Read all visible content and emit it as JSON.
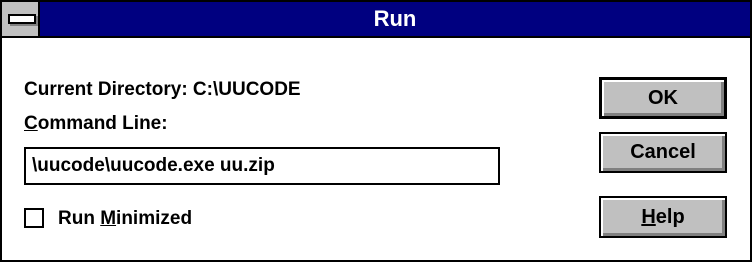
{
  "window": {
    "title": "Run"
  },
  "dialog": {
    "current_directory_label": "Current Directory: C:\\UUCODE",
    "command_line_label_accel": "C",
    "command_line_label_rest": "ommand Line:",
    "command_line_value": "\\uucode\\uucode.exe uu.zip",
    "run_minimized_label_pre": "Run ",
    "run_minimized_label_accel": "M",
    "run_minimized_label_rest": "inimized",
    "run_minimized_checked": false
  },
  "buttons": {
    "ok": "OK",
    "cancel": "Cancel",
    "help_accel": "H",
    "help_rest": "elp"
  },
  "icons": {
    "system_menu": "system-menu-icon"
  },
  "colors": {
    "titlebar": "#000080",
    "button_face": "#c0c0c0",
    "window_bg": "#ffffff"
  }
}
